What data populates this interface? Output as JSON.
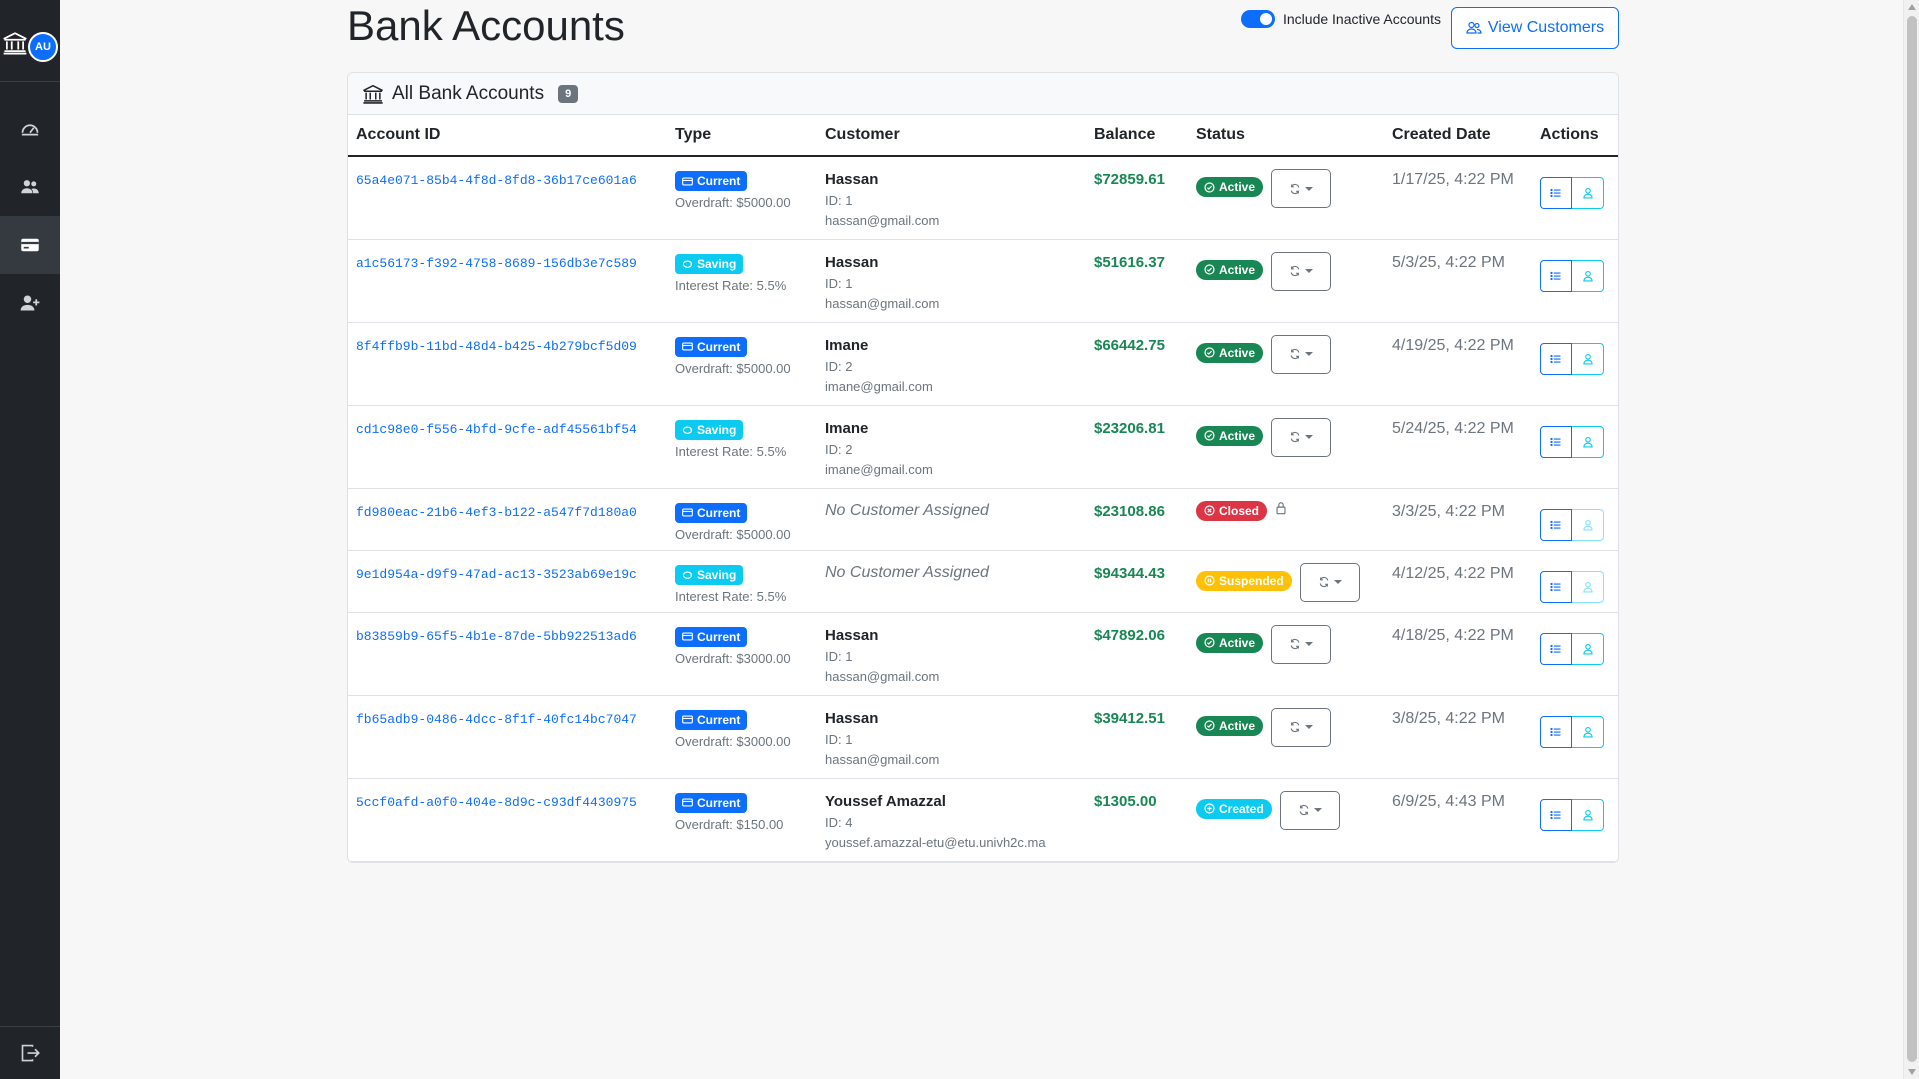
{
  "sidebar": {
    "avatar_initials": "AU",
    "items": [
      {
        "icon": "speedometer-icon",
        "active": false
      },
      {
        "icon": "people-icon",
        "active": false
      },
      {
        "icon": "credit-card-icon",
        "active": true
      },
      {
        "icon": "person-plus-icon",
        "active": false
      }
    ],
    "logout_icon": "logout-icon"
  },
  "header": {
    "title": "Bank Accounts",
    "toggle_label": "Include Inactive Accounts",
    "toggle_on": true,
    "view_customers_label": "View Customers"
  },
  "card": {
    "title": "All Bank Accounts",
    "count": "9"
  },
  "table": {
    "columns": [
      "Account ID",
      "Type",
      "Customer",
      "Balance",
      "Status",
      "Created Date",
      "Actions"
    ],
    "rows": [
      {
        "account_id": "65a4e071-85b4-4f8d-8fd8-36b17ce601a6",
        "type": "Current",
        "type_detail": "Overdraft: $5000.00",
        "customer_name": "Hassan",
        "customer_id": "ID: 1",
        "customer_email": "hassan@gmail.com",
        "balance": "$72859.61",
        "status": "Active",
        "created": "1/17/25, 4:22 PM"
      },
      {
        "account_id": "a1c56173-f392-4758-8689-156db3e7c589",
        "type": "Saving",
        "type_detail": "Interest Rate: 5.5%",
        "customer_name": "Hassan",
        "customer_id": "ID: 1",
        "customer_email": "hassan@gmail.com",
        "balance": "$51616.37",
        "status": "Active",
        "created": "5/3/25, 4:22 PM"
      },
      {
        "account_id": "8f4ffb9b-11bd-48d4-b425-4b279bcf5d09",
        "type": "Current",
        "type_detail": "Overdraft: $5000.00",
        "customer_name": "Imane",
        "customer_id": "ID: 2",
        "customer_email": "imane@gmail.com",
        "balance": "$66442.75",
        "status": "Active",
        "created": "4/19/25, 4:22 PM"
      },
      {
        "account_id": "cd1c98e0-f556-4bfd-9cfe-adf45561bf54",
        "type": "Saving",
        "type_detail": "Interest Rate: 5.5%",
        "customer_name": "Imane",
        "customer_id": "ID: 2",
        "customer_email": "imane@gmail.com",
        "balance": "$23206.81",
        "status": "Active",
        "created": "5/24/25, 4:22 PM"
      },
      {
        "account_id": "fd980eac-21b6-4ef3-b122-a547f7d180a0",
        "type": "Current",
        "type_detail": "Overdraft: $5000.00",
        "no_customer": "No Customer Assigned",
        "balance": "$23108.86",
        "status": "Closed",
        "created": "3/3/25, 4:22 PM"
      },
      {
        "account_id": "9e1d954a-d9f9-47ad-ac13-3523ab69e19c",
        "type": "Saving",
        "type_detail": "Interest Rate: 5.5%",
        "no_customer": "No Customer Assigned",
        "balance": "$94344.43",
        "status": "Suspended",
        "created": "4/12/25, 4:22 PM"
      },
      {
        "account_id": "b83859b9-65f5-4b1e-87de-5bb922513ad6",
        "type": "Current",
        "type_detail": "Overdraft: $3000.00",
        "customer_name": "Hassan",
        "customer_id": "ID: 1",
        "customer_email": "hassan@gmail.com",
        "balance": "$47892.06",
        "status": "Active",
        "created": "4/18/25, 4:22 PM"
      },
      {
        "account_id": "fb65adb9-0486-4dcc-8f1f-40fc14bc7047",
        "type": "Current",
        "type_detail": "Overdraft: $3000.00",
        "customer_name": "Hassan",
        "customer_id": "ID: 1",
        "customer_email": "hassan@gmail.com",
        "balance": "$39412.51",
        "status": "Active",
        "created": "3/8/25, 4:22 PM"
      },
      {
        "account_id": "5ccf0afd-a0f0-404e-8d9c-c93df4430975",
        "type": "Current",
        "type_detail": "Overdraft: $150.00",
        "customer_name": "Youssef Amazzal",
        "customer_id": "ID: 4",
        "customer_email": "youssef.amazzal-etu@etu.univh2c.ma",
        "balance": "$1305.00",
        "status": "Created",
        "created": "6/9/25, 4:43 PM"
      }
    ]
  },
  "colors": {
    "primary": "#0d6efd",
    "success": "#198754",
    "danger": "#dc3545",
    "warning": "#ffc107",
    "info": "#0dcaf0",
    "sidebar_bg": "#212529"
  }
}
